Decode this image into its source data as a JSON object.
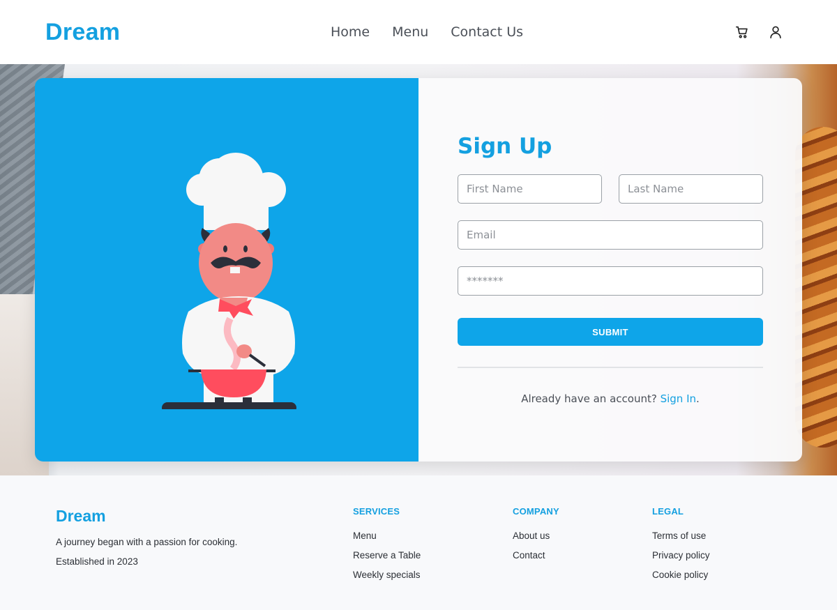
{
  "header": {
    "brand": "Dream",
    "nav": [
      "Home",
      "Menu",
      "Contact Us"
    ],
    "icons": [
      "cart-icon",
      "user-icon"
    ]
  },
  "signup": {
    "title": "Sign Up",
    "first_name_placeholder": "First Name",
    "last_name_placeholder": "Last Name",
    "email_placeholder": "Email",
    "password_placeholder": "*******",
    "submit_label": "SUBMIT",
    "already_text": "Already have an account?",
    "signin_link": "Sign In",
    "signin_suffix": "."
  },
  "footer": {
    "brand": "Dream",
    "tagline": "A journey began with a passion for cooking.",
    "established": "Established in 2023",
    "services": {
      "heading": "SERVICES",
      "links": [
        "Menu",
        "Reserve a Table",
        "Weekly specials"
      ]
    },
    "company": {
      "heading": "COMPANY",
      "links": [
        "About us",
        "Contact"
      ]
    },
    "legal": {
      "heading": "LEGAL",
      "links": [
        "Terms of use",
        "Privacy policy",
        "Cookie policy"
      ]
    }
  },
  "colors": {
    "accent": "#0ea5e9",
    "brand_text": "#14a0e0"
  }
}
